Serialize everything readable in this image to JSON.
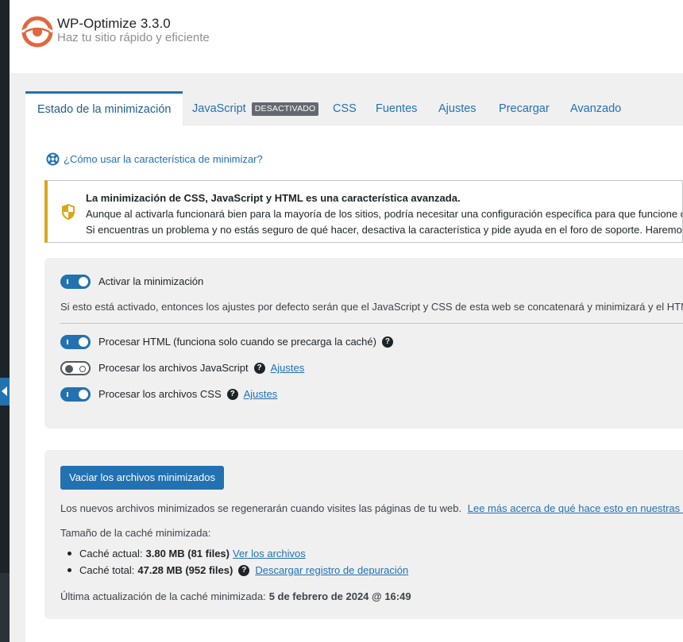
{
  "app": {
    "title": "WP-Optimize 3.3.0",
    "subtitle": "Haz tu sitio rápido y eficiente",
    "accent": "#2271b1",
    "brand": "#e2673f"
  },
  "tabs": [
    {
      "label": "Estado de la minimización",
      "active": true
    },
    {
      "label": "JavaScript",
      "badge": "DESACTIVADO"
    },
    {
      "label": "CSS"
    },
    {
      "label": "Fuentes"
    },
    {
      "label": "Ajustes"
    },
    {
      "label": "Precargar"
    },
    {
      "label": "Avanzado"
    }
  ],
  "help_link": "¿Cómo usar la característica de minimizar?",
  "notice": {
    "heading": "La minimización de CSS, JavaScript y HTML es una característica avanzada.",
    "line1": "Aunque al activarla funcionará bien para la mayoría de los sitios, podría necesitar una configuración específica para que funcione co",
    "line2": "Si encuentras un problema y no estás seguro de qué hacer, desactiva la característica y pide ayuda en el foro de soporte. Haremos t",
    "color": "#dba617"
  },
  "settings": {
    "enable": {
      "label": "Activar la minimización",
      "on": true
    },
    "enable_desc": "Si esto está activado, entonces los ajustes por defecto serán que el JavaScript y CSS de esta web se concatenará y minimizará y el HTML s",
    "html": {
      "label": "Procesar HTML (funciona solo cuando se precarga la caché)",
      "on": true
    },
    "js": {
      "label": "Procesar los archivos JavaScript",
      "on": false,
      "link": "Ajustes"
    },
    "css": {
      "label": "Procesar los archivos CSS",
      "on": true,
      "link": "Ajustes"
    }
  },
  "cache": {
    "button": "Vaciar los archivos minimizados",
    "regen_text": "Los nuevos archivos minimizados se regenerarán cuando visites las páginas de tu web.",
    "faq_link": "Lee más acerca de qué hace esto en nuestras FAQ",
    "size_heading": "Tamaño de la caché minimizada:",
    "current_label": "Caché actual:",
    "current_value": "3.80 MB (81 files)",
    "current_link": "Ver los archivos",
    "total_label": "Caché total:",
    "total_value": "47.28 MB (952 files)",
    "total_link": "Descargar registro de depuración",
    "last_update_label": "Última actualización de la caché minimizada:",
    "last_update_value": "5 de febrero de 2024 @ 16:49"
  }
}
